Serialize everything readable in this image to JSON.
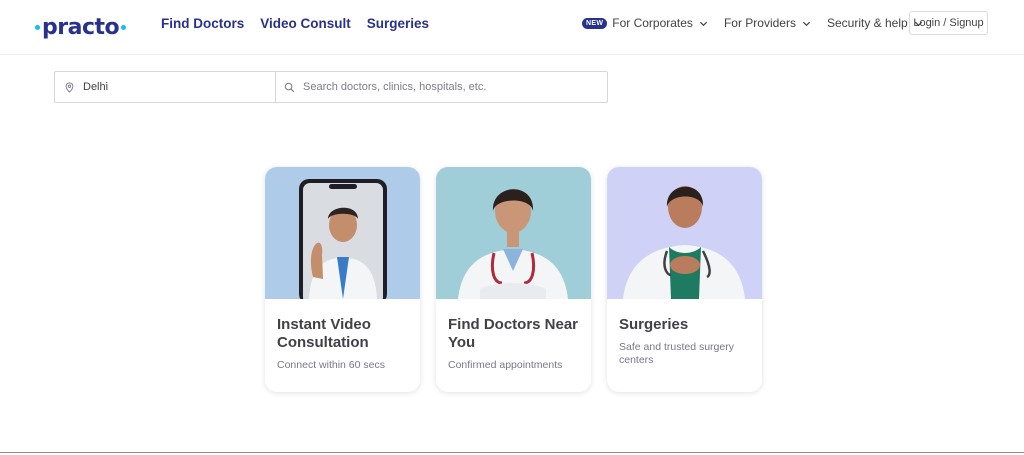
{
  "brand": {
    "name": "practo",
    "accent": "#14bef0",
    "primary": "#28328c"
  },
  "nav": {
    "main": [
      "Find Doctors",
      "Video Consult",
      "Surgeries"
    ],
    "corporates_badge": "NEW",
    "corporates": "For Corporates",
    "providers": "For Providers",
    "security": "Security & help",
    "login": "Login / Signup"
  },
  "search": {
    "location_value": "Delhi",
    "query_placeholder": "Search doctors, clinics, hospitals, etc."
  },
  "cards": [
    {
      "title": "Instant Video Consultation",
      "subtitle": "Connect within 60 secs",
      "bg": "#aecbea"
    },
    {
      "title": "Find Doctors Near You",
      "subtitle": "Confirmed appointments",
      "bg": "#9fcdd8"
    },
    {
      "title": "Surgeries",
      "subtitle": "Safe and trusted surgery centers",
      "bg": "#cfd2f6"
    }
  ]
}
